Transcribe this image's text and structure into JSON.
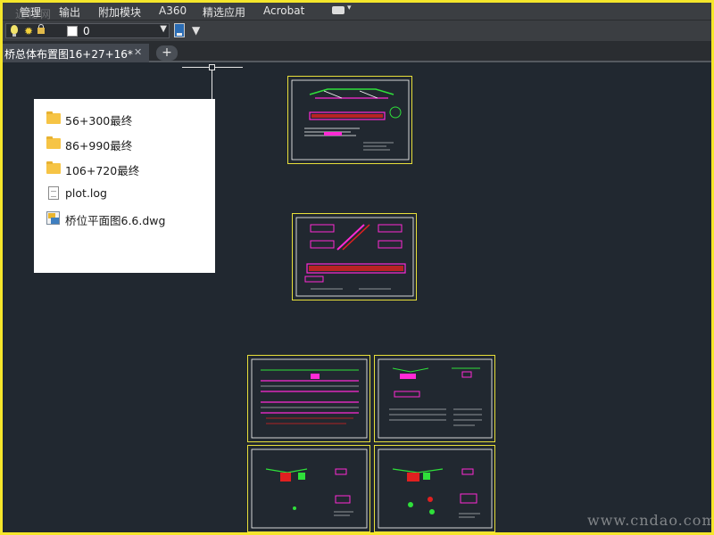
{
  "menubar": {
    "items": [
      "管理",
      "输出",
      "附加模块",
      "A360",
      "精选应用",
      "Acrobat"
    ],
    "extra_icon": "window-icon"
  },
  "watermark_top": "近秘网",
  "layer_toolbar": {
    "current_layer": "0",
    "layer_color": "#ffffff"
  },
  "tabs": {
    "document": "桥总体布置图16+27+16*",
    "close_glyph": "✕",
    "new_tab_glyph": "+"
  },
  "file_popup": {
    "items": [
      {
        "type": "folder",
        "name": "56+300最终"
      },
      {
        "type": "folder",
        "name": "86+990最终"
      },
      {
        "type": "folder",
        "name": "106+720最终"
      },
      {
        "type": "file",
        "name": "plot.log"
      },
      {
        "type": "dwg",
        "name": "桥位平面图6.6.dwg"
      }
    ]
  },
  "watermark_bottom": "www.cndao.com",
  "colors": {
    "canvas": "#212830",
    "sheet_border": "#e8df3a",
    "frame": "#f5e62b"
  }
}
